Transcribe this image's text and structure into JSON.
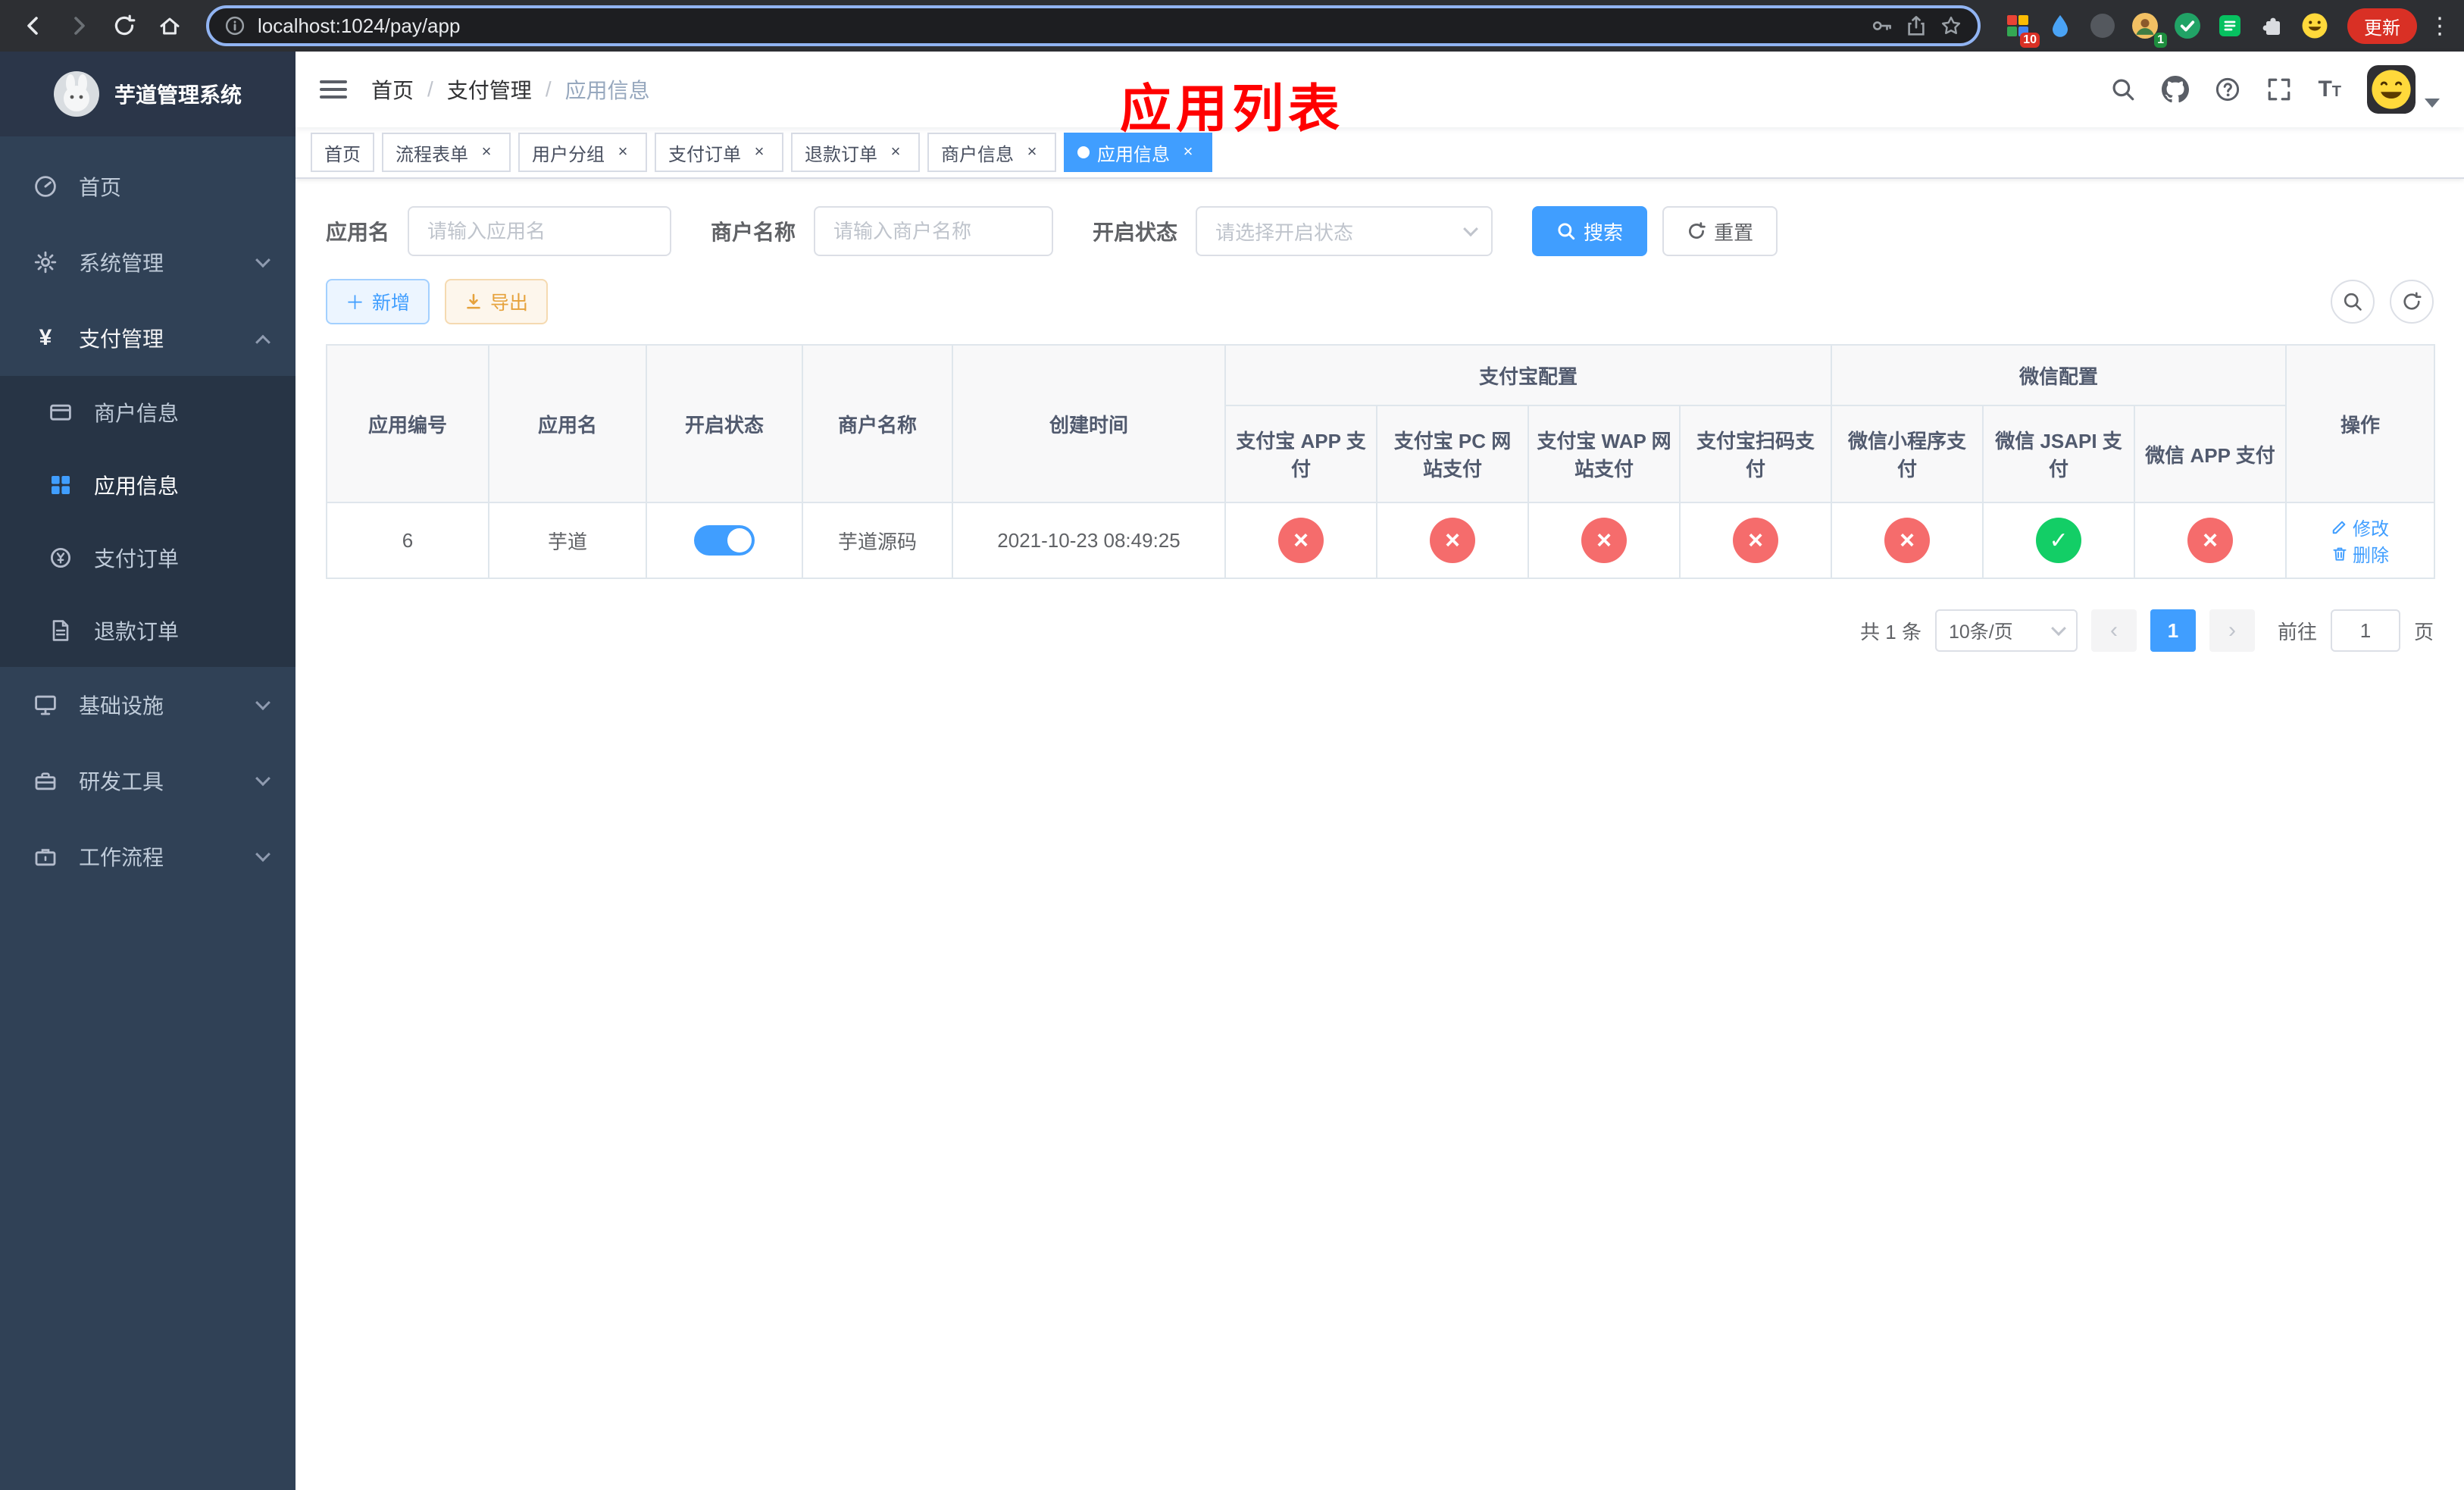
{
  "browser": {
    "url": "localhost:1024/pay/app",
    "update_label": "更新",
    "ext_badge_10": "10",
    "ext_badge_1": "1"
  },
  "sidebar": {
    "title": "芋道管理系统",
    "items": {
      "home": "首页",
      "system": "系统管理",
      "pay": "支付管理",
      "merchant": "商户信息",
      "app": "应用信息",
      "order": "支付订单",
      "refund": "退款订单",
      "infra": "基础设施",
      "dev": "研发工具",
      "workflow": "工作流程"
    }
  },
  "navbar": {
    "breadcrumb": [
      "首页",
      "支付管理",
      "应用信息"
    ],
    "annotation": "应用列表"
  },
  "tabs": [
    {
      "label": "首页"
    },
    {
      "label": "流程表单"
    },
    {
      "label": "用户分组"
    },
    {
      "label": "支付订单"
    },
    {
      "label": "退款订单"
    },
    {
      "label": "商户信息"
    },
    {
      "label": "应用信息"
    }
  ],
  "filters": {
    "app_name_label": "应用名",
    "app_name_placeholder": "请输入应用名",
    "merchant_label": "商户名称",
    "merchant_placeholder": "请输入商户名称",
    "status_label": "开启状态",
    "status_placeholder": "请选择开启状态",
    "search_label": "搜索",
    "reset_label": "重置"
  },
  "toolbar": {
    "add_label": "新增",
    "export_label": "导出"
  },
  "table": {
    "headers": {
      "app_id": "应用编号",
      "app_name": "应用名",
      "status": "开启状态",
      "merchant": "商户名称",
      "created": "创建时间",
      "alipay_group": "支付宝配置",
      "wechat_group": "微信配置",
      "alipay_app": "支付宝 APP 支付",
      "alipay_pc": "支付宝 PC 网站支付",
      "alipay_wap": "支付宝 WAP 网站支付",
      "alipay_qr": "支付宝扫码支付",
      "wx_lite": "微信小程序支付",
      "wx_jsapi": "微信 JSAPI 支付",
      "wx_app": "微信 APP 支付",
      "actions": "操作"
    },
    "rows": [
      {
        "app_id": "6",
        "app_name": "芋道",
        "status_on": true,
        "merchant": "芋道源码",
        "created": "2021-10-23 08:49:25",
        "channels": [
          false,
          false,
          false,
          false,
          false,
          true,
          false
        ],
        "edit_label": "修改",
        "delete_label": "删除"
      }
    ]
  },
  "pagination": {
    "total": "共 1 条",
    "page_size": "10条/页",
    "current_page": "1",
    "goto_label": "前往",
    "goto_value": "1",
    "page_unit": "页"
  },
  "colors": {
    "primary": "#409eff",
    "success": "#13ce66",
    "danger": "#f56c6c",
    "sidebar_bg": "#304156",
    "annotation": "#ff0000"
  }
}
